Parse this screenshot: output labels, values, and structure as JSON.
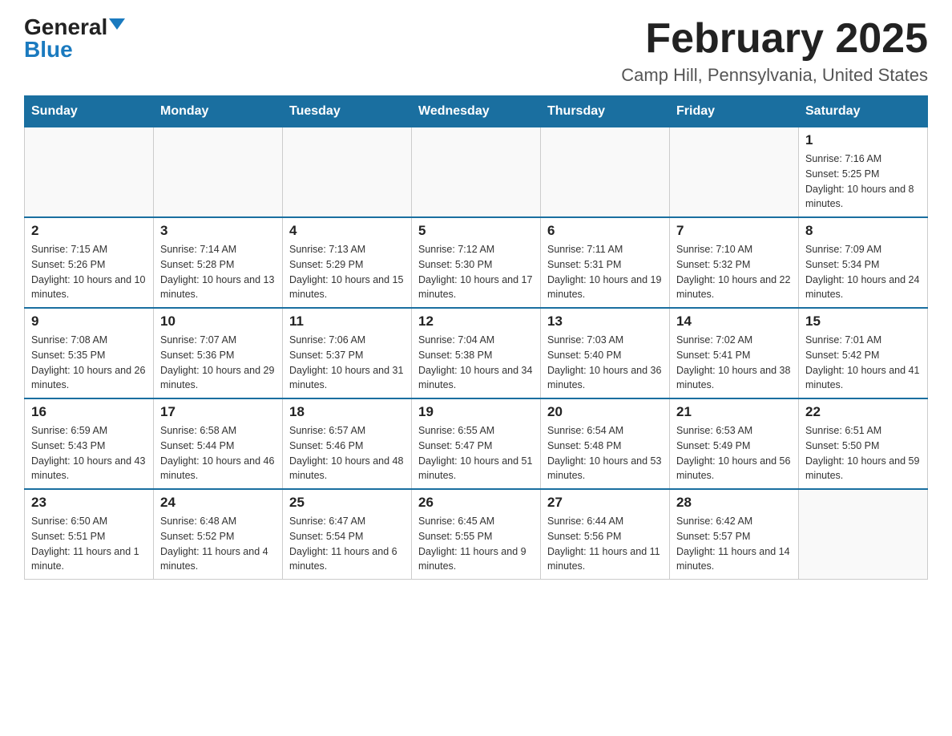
{
  "header": {
    "logo_general": "General",
    "logo_blue": "Blue",
    "month_year": "February 2025",
    "location": "Camp Hill, Pennsylvania, United States"
  },
  "days_of_week": [
    "Sunday",
    "Monday",
    "Tuesday",
    "Wednesday",
    "Thursday",
    "Friday",
    "Saturday"
  ],
  "weeks": [
    [
      {
        "day": "",
        "info": ""
      },
      {
        "day": "",
        "info": ""
      },
      {
        "day": "",
        "info": ""
      },
      {
        "day": "",
        "info": ""
      },
      {
        "day": "",
        "info": ""
      },
      {
        "day": "",
        "info": ""
      },
      {
        "day": "1",
        "info": "Sunrise: 7:16 AM\nSunset: 5:25 PM\nDaylight: 10 hours and 8 minutes."
      }
    ],
    [
      {
        "day": "2",
        "info": "Sunrise: 7:15 AM\nSunset: 5:26 PM\nDaylight: 10 hours and 10 minutes."
      },
      {
        "day": "3",
        "info": "Sunrise: 7:14 AM\nSunset: 5:28 PM\nDaylight: 10 hours and 13 minutes."
      },
      {
        "day": "4",
        "info": "Sunrise: 7:13 AM\nSunset: 5:29 PM\nDaylight: 10 hours and 15 minutes."
      },
      {
        "day": "5",
        "info": "Sunrise: 7:12 AM\nSunset: 5:30 PM\nDaylight: 10 hours and 17 minutes."
      },
      {
        "day": "6",
        "info": "Sunrise: 7:11 AM\nSunset: 5:31 PM\nDaylight: 10 hours and 19 minutes."
      },
      {
        "day": "7",
        "info": "Sunrise: 7:10 AM\nSunset: 5:32 PM\nDaylight: 10 hours and 22 minutes."
      },
      {
        "day": "8",
        "info": "Sunrise: 7:09 AM\nSunset: 5:34 PM\nDaylight: 10 hours and 24 minutes."
      }
    ],
    [
      {
        "day": "9",
        "info": "Sunrise: 7:08 AM\nSunset: 5:35 PM\nDaylight: 10 hours and 26 minutes."
      },
      {
        "day": "10",
        "info": "Sunrise: 7:07 AM\nSunset: 5:36 PM\nDaylight: 10 hours and 29 minutes."
      },
      {
        "day": "11",
        "info": "Sunrise: 7:06 AM\nSunset: 5:37 PM\nDaylight: 10 hours and 31 minutes."
      },
      {
        "day": "12",
        "info": "Sunrise: 7:04 AM\nSunset: 5:38 PM\nDaylight: 10 hours and 34 minutes."
      },
      {
        "day": "13",
        "info": "Sunrise: 7:03 AM\nSunset: 5:40 PM\nDaylight: 10 hours and 36 minutes."
      },
      {
        "day": "14",
        "info": "Sunrise: 7:02 AM\nSunset: 5:41 PM\nDaylight: 10 hours and 38 minutes."
      },
      {
        "day": "15",
        "info": "Sunrise: 7:01 AM\nSunset: 5:42 PM\nDaylight: 10 hours and 41 minutes."
      }
    ],
    [
      {
        "day": "16",
        "info": "Sunrise: 6:59 AM\nSunset: 5:43 PM\nDaylight: 10 hours and 43 minutes."
      },
      {
        "day": "17",
        "info": "Sunrise: 6:58 AM\nSunset: 5:44 PM\nDaylight: 10 hours and 46 minutes."
      },
      {
        "day": "18",
        "info": "Sunrise: 6:57 AM\nSunset: 5:46 PM\nDaylight: 10 hours and 48 minutes."
      },
      {
        "day": "19",
        "info": "Sunrise: 6:55 AM\nSunset: 5:47 PM\nDaylight: 10 hours and 51 minutes."
      },
      {
        "day": "20",
        "info": "Sunrise: 6:54 AM\nSunset: 5:48 PM\nDaylight: 10 hours and 53 minutes."
      },
      {
        "day": "21",
        "info": "Sunrise: 6:53 AM\nSunset: 5:49 PM\nDaylight: 10 hours and 56 minutes."
      },
      {
        "day": "22",
        "info": "Sunrise: 6:51 AM\nSunset: 5:50 PM\nDaylight: 10 hours and 59 minutes."
      }
    ],
    [
      {
        "day": "23",
        "info": "Sunrise: 6:50 AM\nSunset: 5:51 PM\nDaylight: 11 hours and 1 minute."
      },
      {
        "day": "24",
        "info": "Sunrise: 6:48 AM\nSunset: 5:52 PM\nDaylight: 11 hours and 4 minutes."
      },
      {
        "day": "25",
        "info": "Sunrise: 6:47 AM\nSunset: 5:54 PM\nDaylight: 11 hours and 6 minutes."
      },
      {
        "day": "26",
        "info": "Sunrise: 6:45 AM\nSunset: 5:55 PM\nDaylight: 11 hours and 9 minutes."
      },
      {
        "day": "27",
        "info": "Sunrise: 6:44 AM\nSunset: 5:56 PM\nDaylight: 11 hours and 11 minutes."
      },
      {
        "day": "28",
        "info": "Sunrise: 6:42 AM\nSunset: 5:57 PM\nDaylight: 11 hours and 14 minutes."
      },
      {
        "day": "",
        "info": ""
      }
    ]
  ]
}
